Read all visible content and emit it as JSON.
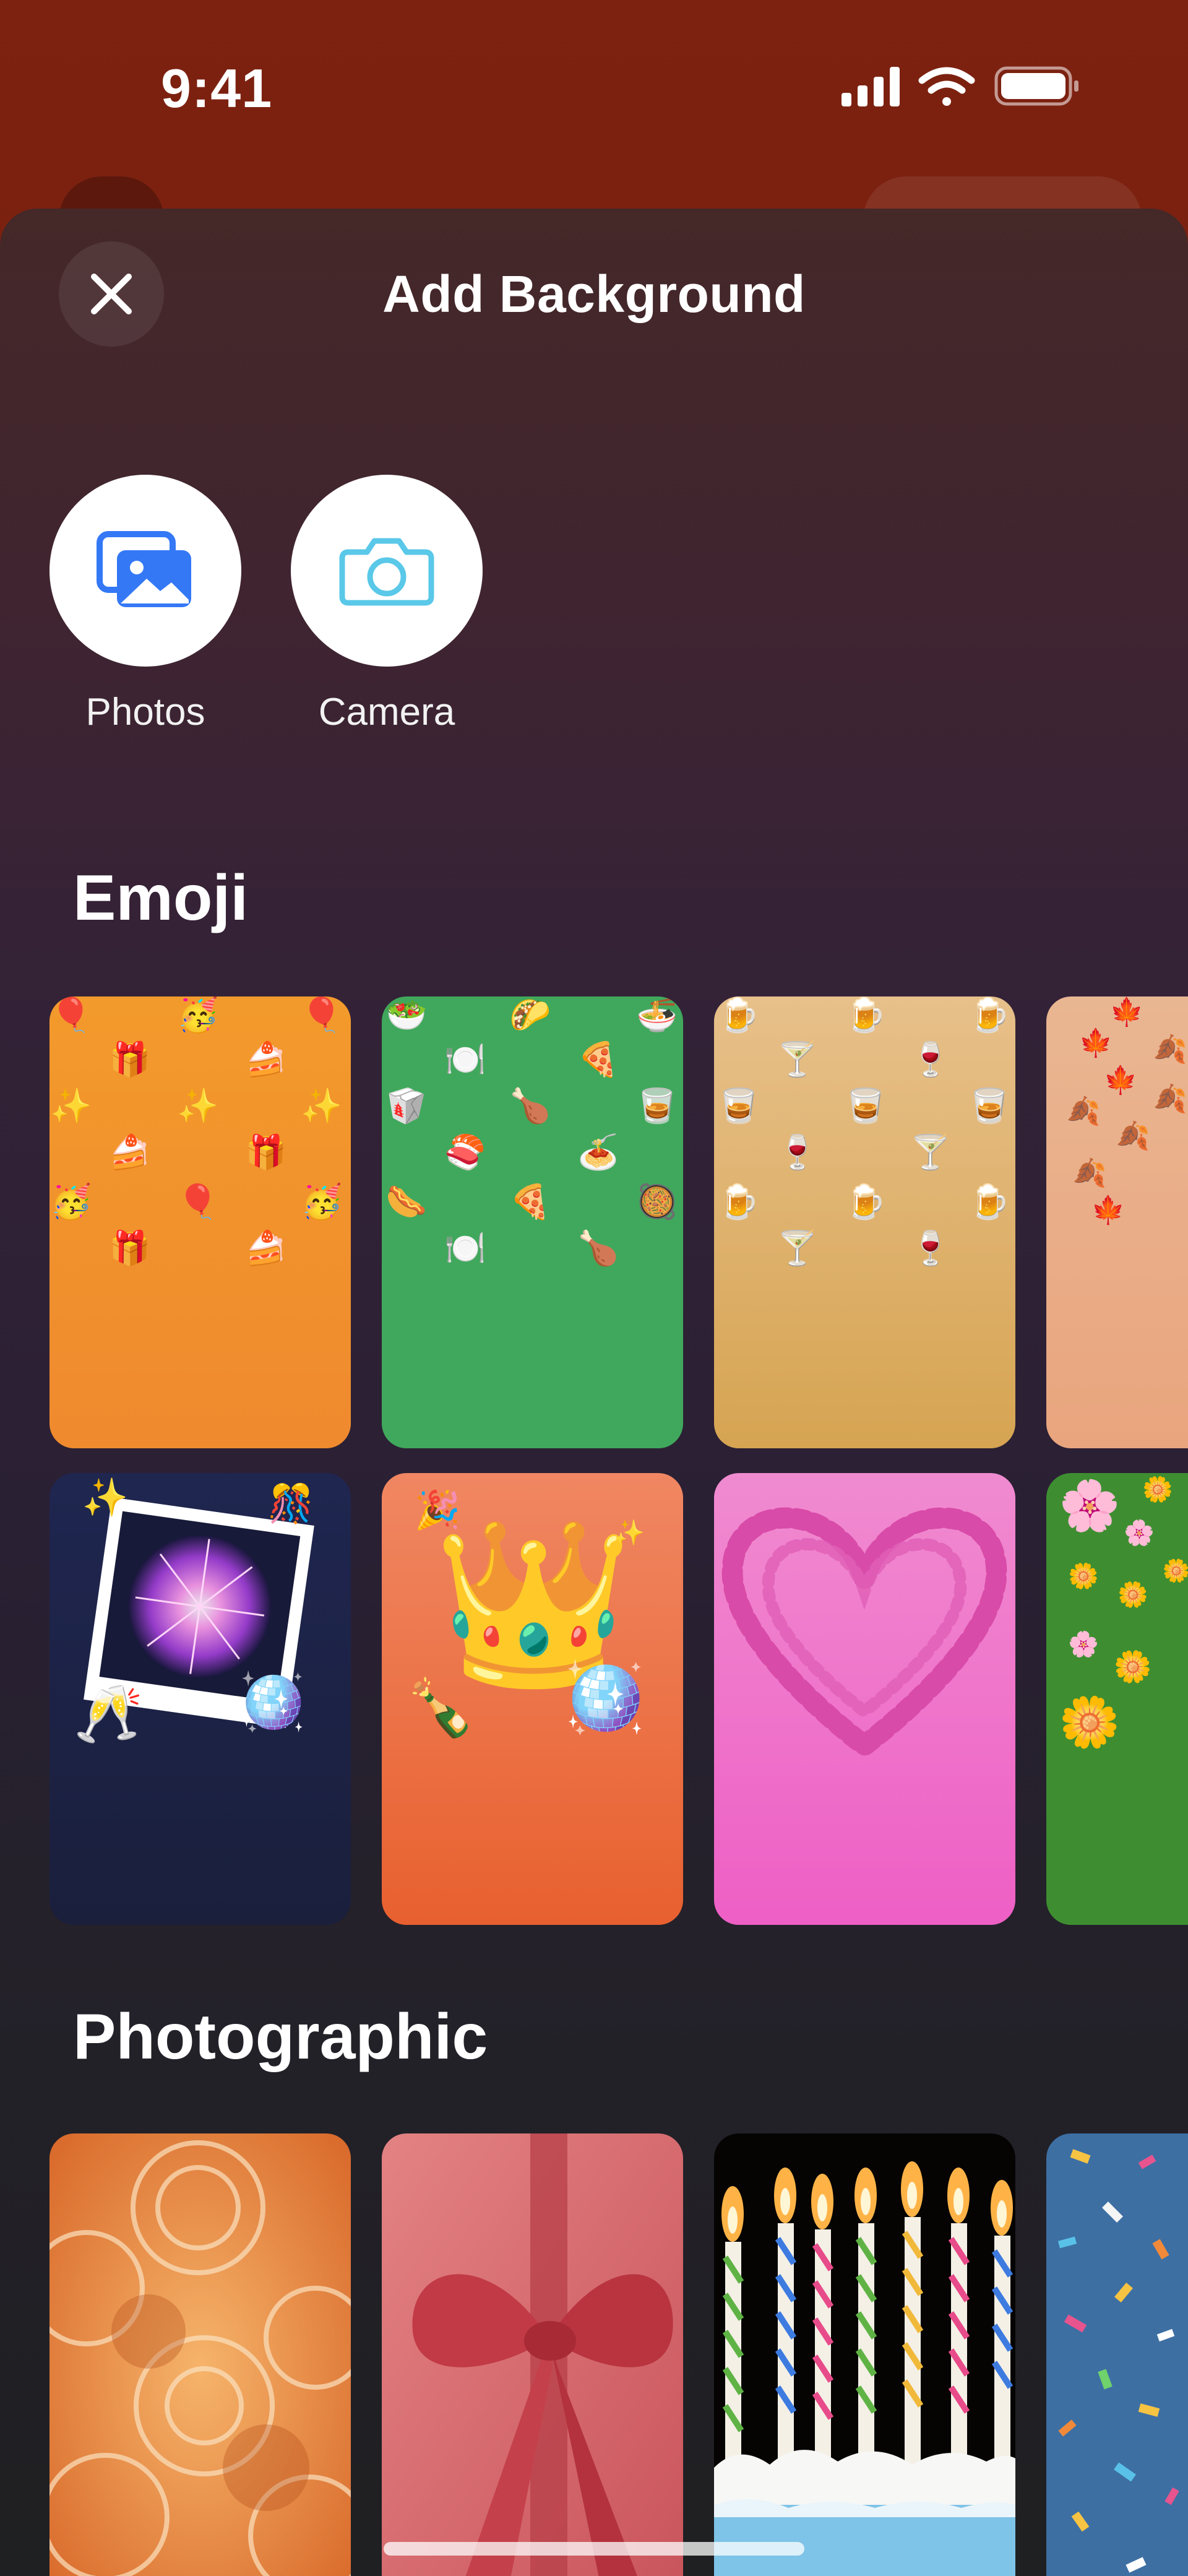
{
  "status_bar": {
    "time": "9:41"
  },
  "sheet": {
    "title": "Add Background",
    "close_icon": "close-icon"
  },
  "sources": [
    {
      "label": "Photos",
      "icon": "photos-icon",
      "color": "#3478f6"
    },
    {
      "label": "Camera",
      "icon": "camera-icon",
      "color": "#5ac8e8"
    }
  ],
  "sections": {
    "emoji": {
      "heading": "Emoji",
      "tiles": [
        {
          "name": "party",
          "emoji": [
            "🎈",
            "🎁",
            "✨",
            "🍰",
            "🥳"
          ],
          "color": "#f48a2a"
        },
        {
          "name": "food",
          "emoji": [
            "🍕",
            "🍽️",
            "🍗",
            "🍣",
            "🌭",
            "🌮",
            "🍜"
          ],
          "color": "#3fa85a"
        },
        {
          "name": "drinks",
          "emoji": [
            "🍺",
            "🍸",
            "🍷",
            "🥃"
          ],
          "color": "#d9a559"
        },
        {
          "name": "autumn-leaves",
          "emoji": [
            "🍁",
            "🍂"
          ],
          "color": "#e9ad86"
        },
        {
          "name": "fireworks-photo",
          "emoji": [
            "🎆",
            "🥂",
            "🪩",
            "✨",
            "🎊"
          ],
          "color": "#1d2347"
        },
        {
          "name": "crown",
          "emoji": [
            "👑",
            "🪩",
            "🍾",
            "🎉",
            "✨"
          ],
          "color": "#ec6637"
        },
        {
          "name": "hearts",
          "emoji": [
            "💗"
          ],
          "color": "#f078c9"
        },
        {
          "name": "flowers",
          "emoji": [
            "🌸",
            "🌼"
          ],
          "color": "#3e8e31"
        }
      ]
    },
    "photographic": {
      "heading": "Photographic",
      "tiles": [
        {
          "name": "glassware",
          "color": "#e07a2b"
        },
        {
          "name": "ribbon",
          "color": "#d35b5b"
        },
        {
          "name": "candles-cake",
          "color": "#7ec3e8"
        },
        {
          "name": "confetti",
          "color": "#3a6ea0"
        }
      ]
    }
  }
}
